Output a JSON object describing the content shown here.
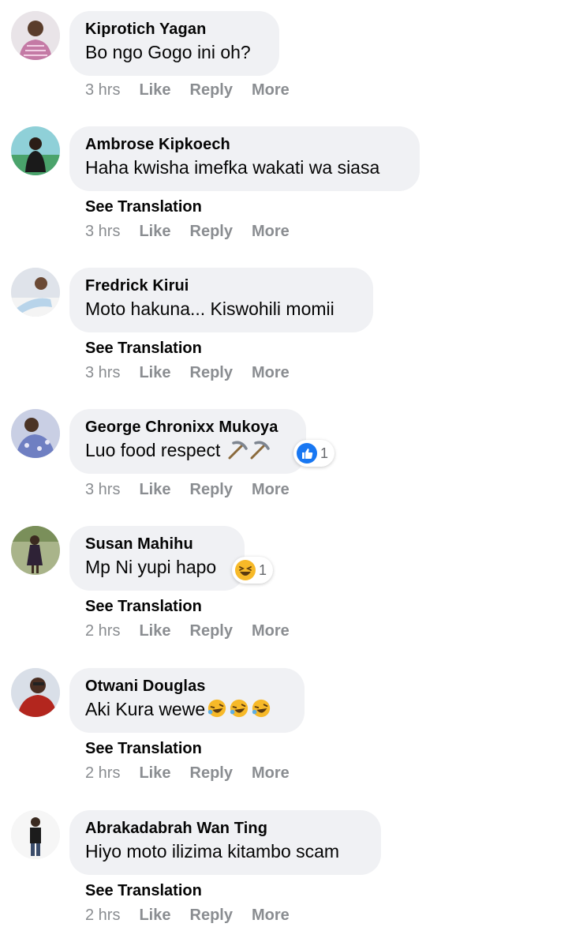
{
  "labels": {
    "see_translation": "See Translation",
    "like": "Like",
    "reply": "Reply",
    "more": "More"
  },
  "comments": [
    {
      "author": "Kiprotich Yagan",
      "text": "Bo ngo Gogo ini oh?",
      "time": "3 hrs",
      "avatar_icon": "profile-photo"
    },
    {
      "author": "Ambrose Kipkoech",
      "text": "Haha kwisha imefka wakati wa siasa",
      "time": "3 hrs",
      "avatar_icon": "profile-photo"
    },
    {
      "author": "Fredrick Kirui",
      "text": "Moto hakuna... Kiswohili momii",
      "time": "3 hrs",
      "avatar_icon": "profile-photo"
    },
    {
      "author": "George Chronixx Mukoya",
      "text": "Luo food respect",
      "emoji": "pick-icon",
      "time": "3 hrs",
      "reaction": {
        "icon": "like-icon",
        "count": "1"
      }
    },
    {
      "author": "Susan Mahihu",
      "text": "Mp Ni yupi hapo",
      "time": "2 hrs",
      "reaction": {
        "icon": "laughing-emoji-icon",
        "count": "1"
      }
    },
    {
      "author": "Otwani Douglas",
      "text": "Aki Kura wewe",
      "emoji": "rofl-emoji-icon",
      "time": "2 hrs"
    },
    {
      "author": "Abrakadabrah Wan Ting",
      "text": "Hiyo moto ilizima kitambo scam",
      "time": "2 hrs"
    }
  ],
  "colors": {
    "bubble": "#f0f1f4",
    "meta": "#8a8d91",
    "like_blue": "#1877f2",
    "emoji_yellow": "#f7b928"
  }
}
